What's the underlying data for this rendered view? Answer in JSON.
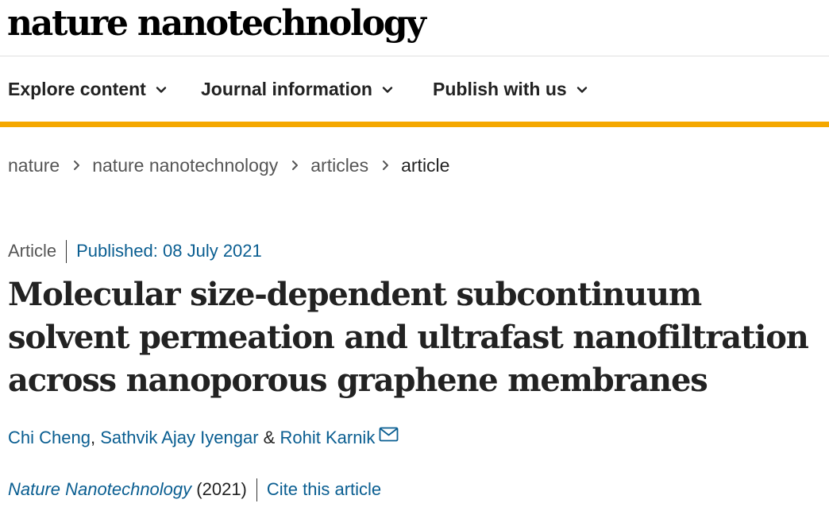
{
  "header": {
    "logo_text": "nature nanotechnology"
  },
  "nav": {
    "items": [
      {
        "label": "Explore content",
        "icon": "chevron-down-icon"
      },
      {
        "label": "Journal information",
        "icon": "chevron-down-icon"
      },
      {
        "label": "Publish with us",
        "icon": "chevron-down-icon"
      }
    ]
  },
  "colors": {
    "accent_bar": "#f5a800",
    "link": "#0a5e91",
    "text": "#222222",
    "muted": "#555555"
  },
  "breadcrumb": {
    "items": [
      "nature",
      "nature nanotechnology",
      "articles",
      "article"
    ],
    "separator_icon": "chevron-right-icon"
  },
  "article": {
    "type": "Article",
    "published_label": "Published:",
    "published_date": "08 July 2021",
    "title": "Molecular size-dependent subcontinuum solvent permeation and ultrafast nanofiltration across nanoporous graphene membranes",
    "authors": [
      {
        "name": "Chi Cheng"
      },
      {
        "name": "Sathvik Ajay Iyengar"
      },
      {
        "name": "Rohit Karnik"
      }
    ],
    "authors_comma": ",",
    "authors_and": "&",
    "contact_icon": "mail-icon",
    "journal": "Nature Nanotechnology",
    "year": "(2021)",
    "cite_label": "Cite this article"
  }
}
